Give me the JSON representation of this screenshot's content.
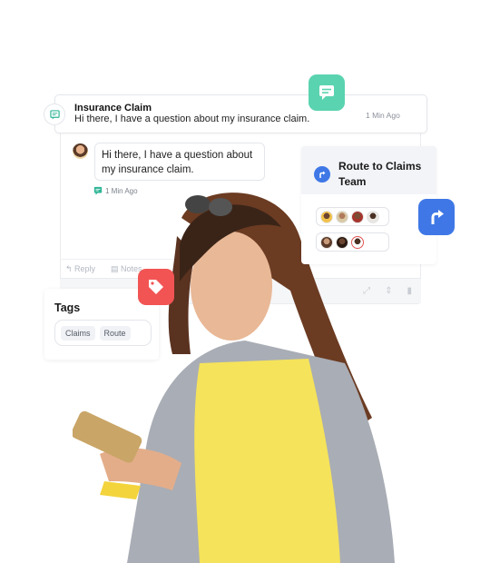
{
  "conversation": {
    "title": "Insurance Claim",
    "preview": "Hi there, I have a question about my insurance claim.",
    "time": "1 Min Ago",
    "channel_icon": "chat-message-icon"
  },
  "message": {
    "text": "Hi there, I have a question about my insurance claim.",
    "time": "1 Min Ago",
    "channel_icon": "chat-message-icon"
  },
  "composer": {
    "tabs": [
      {
        "label": "Reply",
        "icon": "reply-arrow-icon"
      },
      {
        "label": "Notes",
        "icon": "notes-icon"
      }
    ],
    "footer_icons": [
      "expand-icon",
      "up-down-chevron-icon",
      "trash-icon"
    ]
  },
  "route": {
    "title": "Route to Claims Team",
    "agent_rows": [
      {
        "count": 4
      },
      {
        "count": 3
      }
    ]
  },
  "tags": {
    "title": "Tags",
    "items": [
      "Claims",
      "Route"
    ]
  },
  "badges": {
    "chat": {
      "icon": "chat-icon",
      "color": "#5ad3b0"
    },
    "route": {
      "icon": "route-arrow-icon",
      "color": "#3f78e6"
    },
    "tag": {
      "icon": "tag-icon",
      "color": "#f25454"
    }
  }
}
